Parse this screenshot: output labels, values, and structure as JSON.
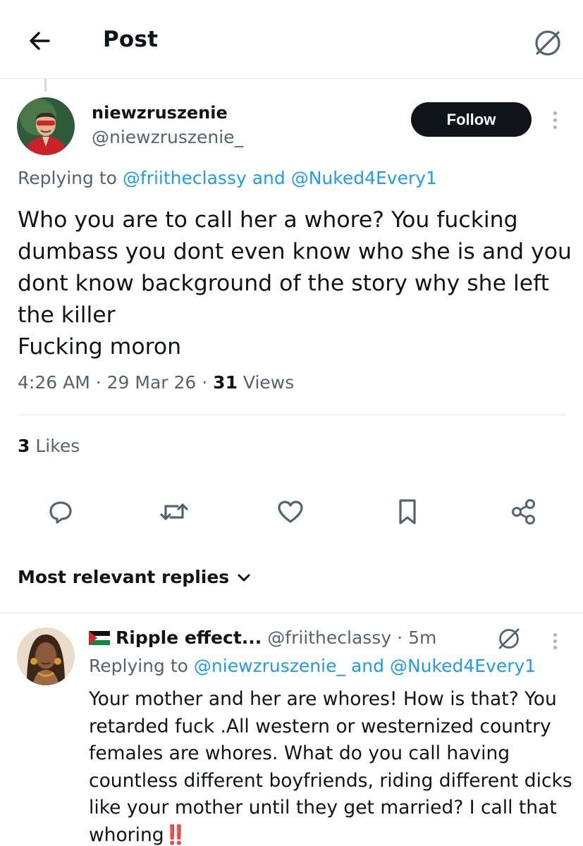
{
  "header": {
    "title": "Post",
    "back_icon": "arrow-left-icon",
    "grok_icon": "grok-icon"
  },
  "post": {
    "author": {
      "display_name": "niewzruszenie",
      "handle": "@niewzruszenie_",
      "avatar_icon": "user-avatar"
    },
    "follow_label": "Follow",
    "replying_prefix": "Replying to",
    "replying_to_1": "@friitheclassy",
    "replying_and": "and",
    "replying_to_2": "@Nuked4Every1",
    "text_lines": [
      "Who you are to call her a whore? You fucking",
      "dumbass you dont even know who she is and you",
      "dont know background of the story why she left",
      "the killer",
      "Fucking moron"
    ],
    "time": "4:26 AM",
    "date": "29 Mar 26",
    "views_count": "31",
    "views_label": "Views",
    "likes_count": "3",
    "likes_label": "Likes"
  },
  "actions": {
    "reply_icon": "reply-icon",
    "repost_icon": "repost-icon",
    "like_icon": "heart-icon",
    "bookmark_icon": "bookmark-icon",
    "share_icon": "share-icon"
  },
  "replies_sort": {
    "label": "Most relevant replies",
    "icon": "chevron-down-icon"
  },
  "reply": {
    "flag_icon": "palestine-flag-icon",
    "display_name": "Ripple effect...",
    "handle": "@friitheclassy",
    "time": "5m",
    "replying_prefix": "Replying to",
    "replying_to_1": "@niewzruszenie_",
    "replying_and": "and",
    "replying_to_2": "@Nuked4Every1",
    "text_lines": [
      "Your mother and her are whores! How is that? You",
      "retarded fuck .All western or westernized country",
      "females are whores. What do you call having",
      "countless different boyfriends, riding different dicks",
      "like your mother until they get married? I call that",
      "whoring"
    ],
    "emphasis": "‼️"
  },
  "colors": {
    "accent": "#1d9bf0",
    "secondary_text": "#536471",
    "primary_text": "#0f1419",
    "divider": "#e6e9eb"
  }
}
